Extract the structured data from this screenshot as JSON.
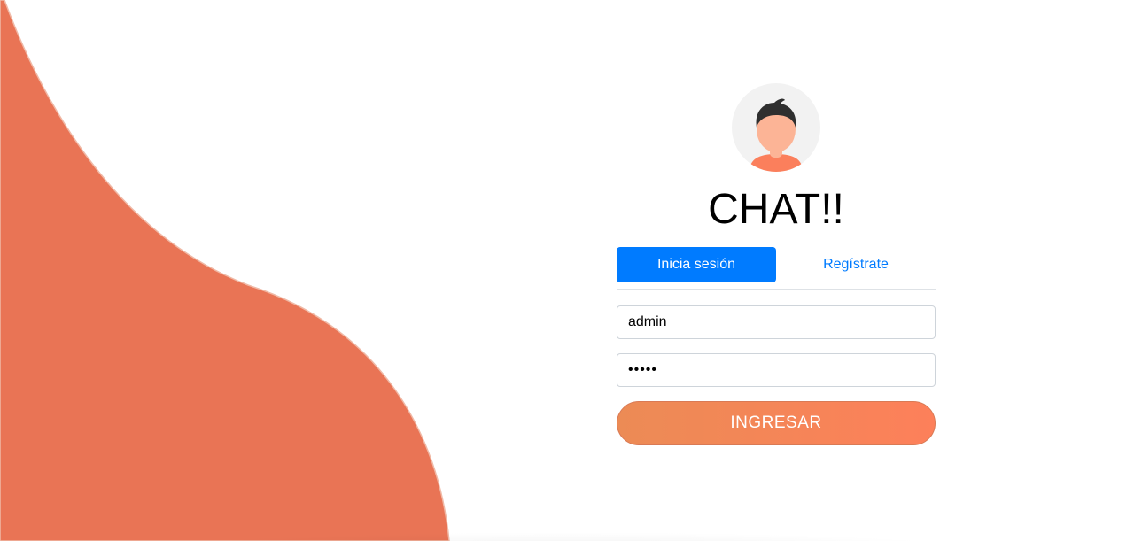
{
  "login": {
    "title": "CHAT!!",
    "tabs": [
      {
        "label": "Inicia sesión",
        "active": true
      },
      {
        "label": "Regístrate",
        "active": false
      }
    ],
    "username_value": "admin",
    "password_value": "•••••",
    "submit_label": "INGRESAR"
  },
  "colors": {
    "accent_blue": "#007bff",
    "wave_orange": "#e97455",
    "button_gradient_start": "#ec8b55",
    "button_gradient_end": "#fd805a"
  },
  "icons": {
    "avatar": "user-avatar-icon"
  }
}
